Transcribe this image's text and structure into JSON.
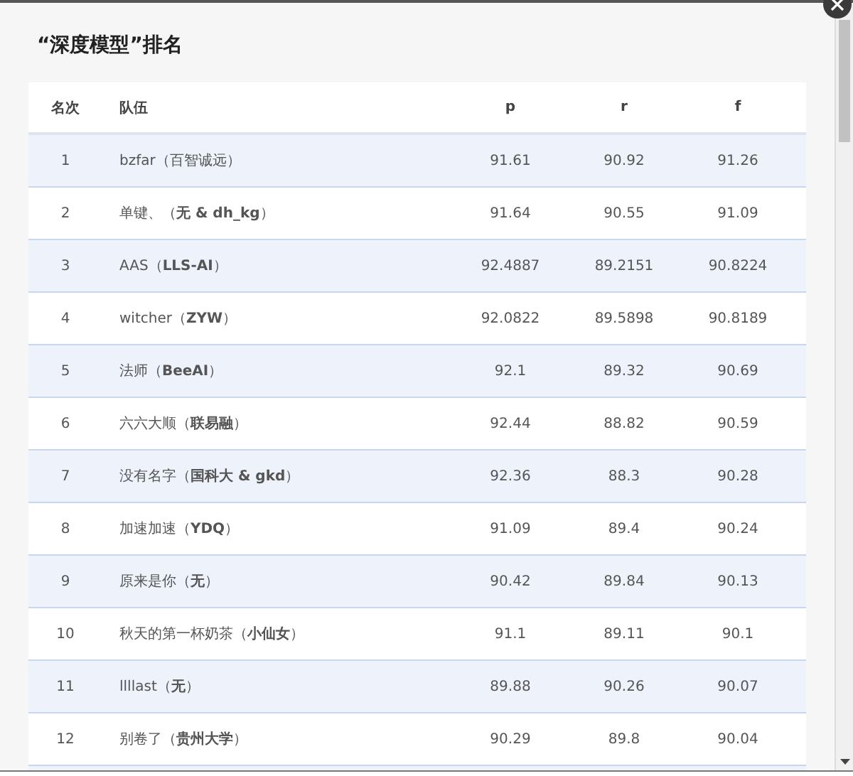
{
  "dialog": {
    "title": "“深度模型”排名"
  },
  "table": {
    "columns": [
      "名次",
      "队伍",
      "p",
      "r",
      "f"
    ],
    "rows": [
      {
        "rank": "1",
        "team": "bzfar（百智诚远）",
        "p": "91.61",
        "r": "90.92",
        "f": "91.26"
      },
      {
        "rank": "2",
        "team": "单键、（**无 & dh_kg**）",
        "p": "91.64",
        "r": "90.55",
        "f": "91.09"
      },
      {
        "rank": "3",
        "team": "AAS（**LLS-AI**）",
        "p": "92.4887",
        "r": "89.2151",
        "f": "90.8224"
      },
      {
        "rank": "4",
        "team": "witcher（**ZYW**）",
        "p": "92.0822",
        "r": "89.5898",
        "f": "90.8189"
      },
      {
        "rank": "5",
        "team": "法师（**BeeAI**）",
        "p": "92.1",
        "r": "89.32",
        "f": "90.69"
      },
      {
        "rank": "6",
        "team": "六六大顺（**联易融**）",
        "p": "92.44",
        "r": "88.82",
        "f": "90.59"
      },
      {
        "rank": "7",
        "team": "没有名字（**国科大 & gkd**）",
        "p": "92.36",
        "r": "88.3",
        "f": "90.28"
      },
      {
        "rank": "8",
        "team": "加速加速（**YDQ**）",
        "p": "91.09",
        "r": "89.4",
        "f": "90.24"
      },
      {
        "rank": "9",
        "team": "原来是你（**无**）",
        "p": "90.42",
        "r": "89.84",
        "f": "90.13"
      },
      {
        "rank": "10",
        "team": "秋天的第一杯奶茶（**小仙女**）",
        "p": "91.1",
        "r": "89.11",
        "f": "90.1"
      },
      {
        "rank": "11",
        "team": "llllast（**无**）",
        "p": "89.88",
        "r": "90.26",
        "f": "90.07"
      },
      {
        "rank": "12",
        "team": "别卷了（**贵州大学**）",
        "p": "90.29",
        "r": "89.8",
        "f": "90.04"
      }
    ]
  }
}
